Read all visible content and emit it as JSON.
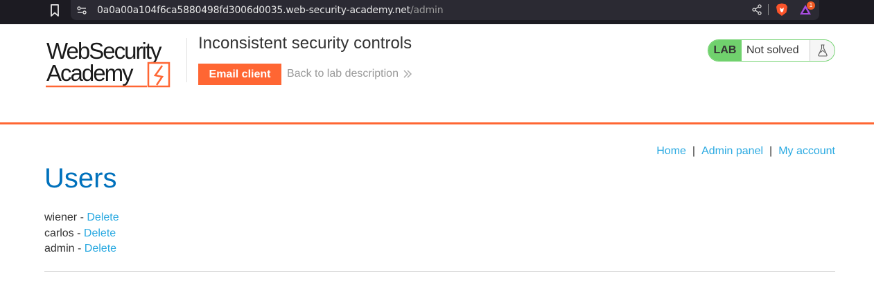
{
  "browser": {
    "url_host": "0a0a00a104f6ca5880498fd3006d0035.web-security-academy.net",
    "url_path": "/admin",
    "rewards_badge": "1"
  },
  "header": {
    "logo_line1": "WebSecurity",
    "logo_line2": "Academy",
    "lab_title": "Inconsistent security controls",
    "email_client_label": "Email client",
    "back_link_label": "Back to lab description",
    "status_lab_label": "LAB",
    "status_text": "Not solved"
  },
  "nav": {
    "home": "Home",
    "admin_panel": "Admin panel",
    "my_account": "My account",
    "separator": "|"
  },
  "main": {
    "heading": "Users",
    "users": [
      {
        "name": "wiener",
        "dash": " - ",
        "action": "Delete"
      },
      {
        "name": "carlos",
        "dash": " - ",
        "action": "Delete"
      },
      {
        "name": "admin",
        "dash": " - ",
        "action": "Delete"
      }
    ]
  },
  "colors": {
    "accent_orange": "#ff6633",
    "link_blue": "#29a9e1",
    "heading_blue": "#0071bc",
    "status_green": "#70d16d"
  }
}
